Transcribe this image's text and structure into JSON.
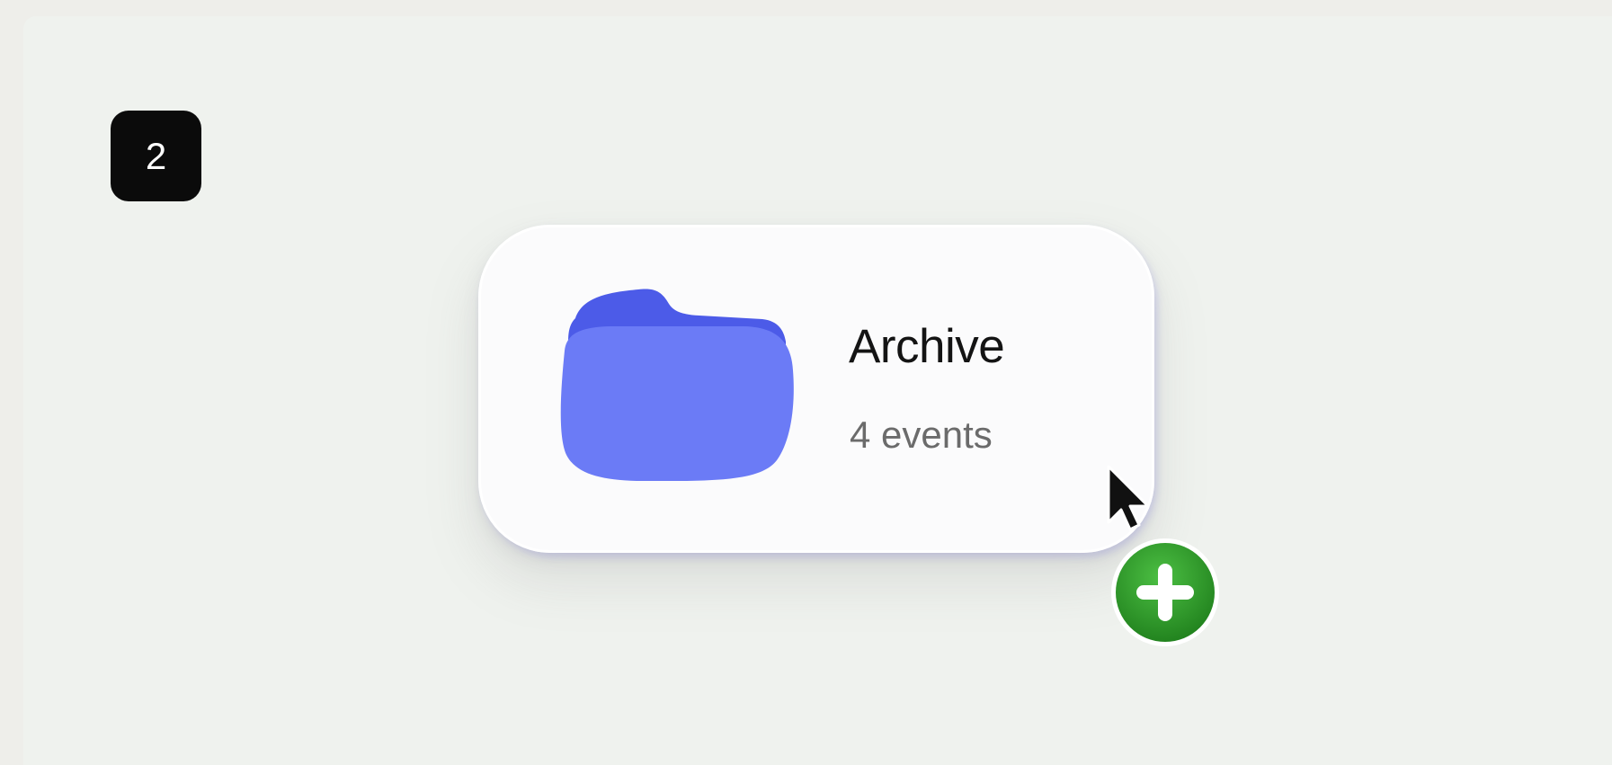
{
  "step": {
    "number": "2"
  },
  "card": {
    "title": "Archive",
    "subtitle": "4 events",
    "icon": "folder-icon",
    "icon_colors": {
      "back": "#4c5be8",
      "front": "#6b7bf6"
    }
  },
  "cursor": {
    "icon": "arrow-cursor-icon",
    "badge_icon": "plus-icon",
    "badge_color": "#2f9b2c"
  }
}
